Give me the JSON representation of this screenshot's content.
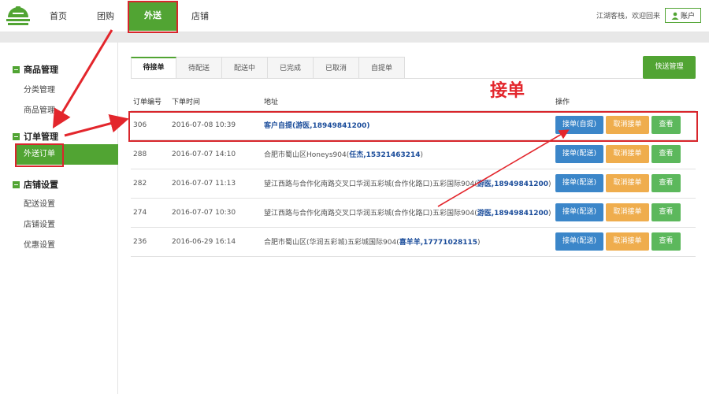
{
  "nav": {
    "items": [
      {
        "label": "首页"
      },
      {
        "label": "团购"
      },
      {
        "label": "外送"
      },
      {
        "label": "店铺"
      }
    ],
    "greeting": "江湖客栈，欢迎回来",
    "account_label": "账户"
  },
  "sidebar": {
    "sections": [
      {
        "title": "商品管理",
        "items": [
          {
            "label": "分类管理"
          },
          {
            "label": "商品管理"
          }
        ]
      },
      {
        "title": "订单管理",
        "items": [
          {
            "label": "外送订单"
          }
        ]
      },
      {
        "title": "店铺设置",
        "items": [
          {
            "label": "配送设置"
          },
          {
            "label": "店铺设置"
          },
          {
            "label": "优惠设置"
          }
        ]
      }
    ]
  },
  "main": {
    "tabs": [
      {
        "label": "待接单"
      },
      {
        "label": "待配送"
      },
      {
        "label": "配送中"
      },
      {
        "label": "已完成"
      },
      {
        "label": "已取消"
      },
      {
        "label": "自提单"
      }
    ],
    "quick_manage": "快送管理",
    "columns": {
      "id": "订单编号",
      "time": "下单时间",
      "address": "地址",
      "action": "操作"
    },
    "rows": [
      {
        "id": "306",
        "time": "2016-07-08 10:39",
        "address_plain": "",
        "address_link": "客户自提(游医,18949841200)",
        "accept": "接单(自提)",
        "cancel": "取消接单",
        "view": "查看"
      },
      {
        "id": "288",
        "time": "2016-07-07 14:10",
        "address_plain": "合肥市蜀山区Honeys904(",
        "address_link": "任杰,15321463214",
        "address_tail": ")",
        "accept": "接单(配送)",
        "cancel": "取消接单",
        "view": "查看"
      },
      {
        "id": "282",
        "time": "2016-07-07 11:13",
        "address_plain": "望江西路与合作化南路交叉口华润五彩城(合作化路口)五彩国际904(",
        "address_link": "游医,18949841200",
        "address_tail": ")",
        "accept": "接单(配送)",
        "cancel": "取消接单",
        "view": "查看"
      },
      {
        "id": "274",
        "time": "2016-07-07 10:30",
        "address_plain": "望江西路与合作化南路交叉口华润五彩城(合作化路口)五彩国际904(",
        "address_link": "游医,18949841200",
        "address_tail": ")",
        "accept": "接单(配送)",
        "cancel": "取消接单",
        "view": "查看"
      },
      {
        "id": "236",
        "time": "2016-06-29 16:14",
        "address_plain": "合肥市蜀山区(华润五彩城)五彩城国际904(",
        "address_link": "喜羊羊,17771028115",
        "address_tail": ")",
        "accept": "接单(配送)",
        "cancel": "取消接单",
        "view": "查看"
      }
    ]
  },
  "annotation": {
    "label": "接单",
    "color": "#e3262c"
  },
  "colors": {
    "brand_green": "#51a433",
    "blue": "#3b86c9",
    "orange": "#efad4d",
    "green_btn": "#5cb85c",
    "link": "#1a4c9a"
  }
}
